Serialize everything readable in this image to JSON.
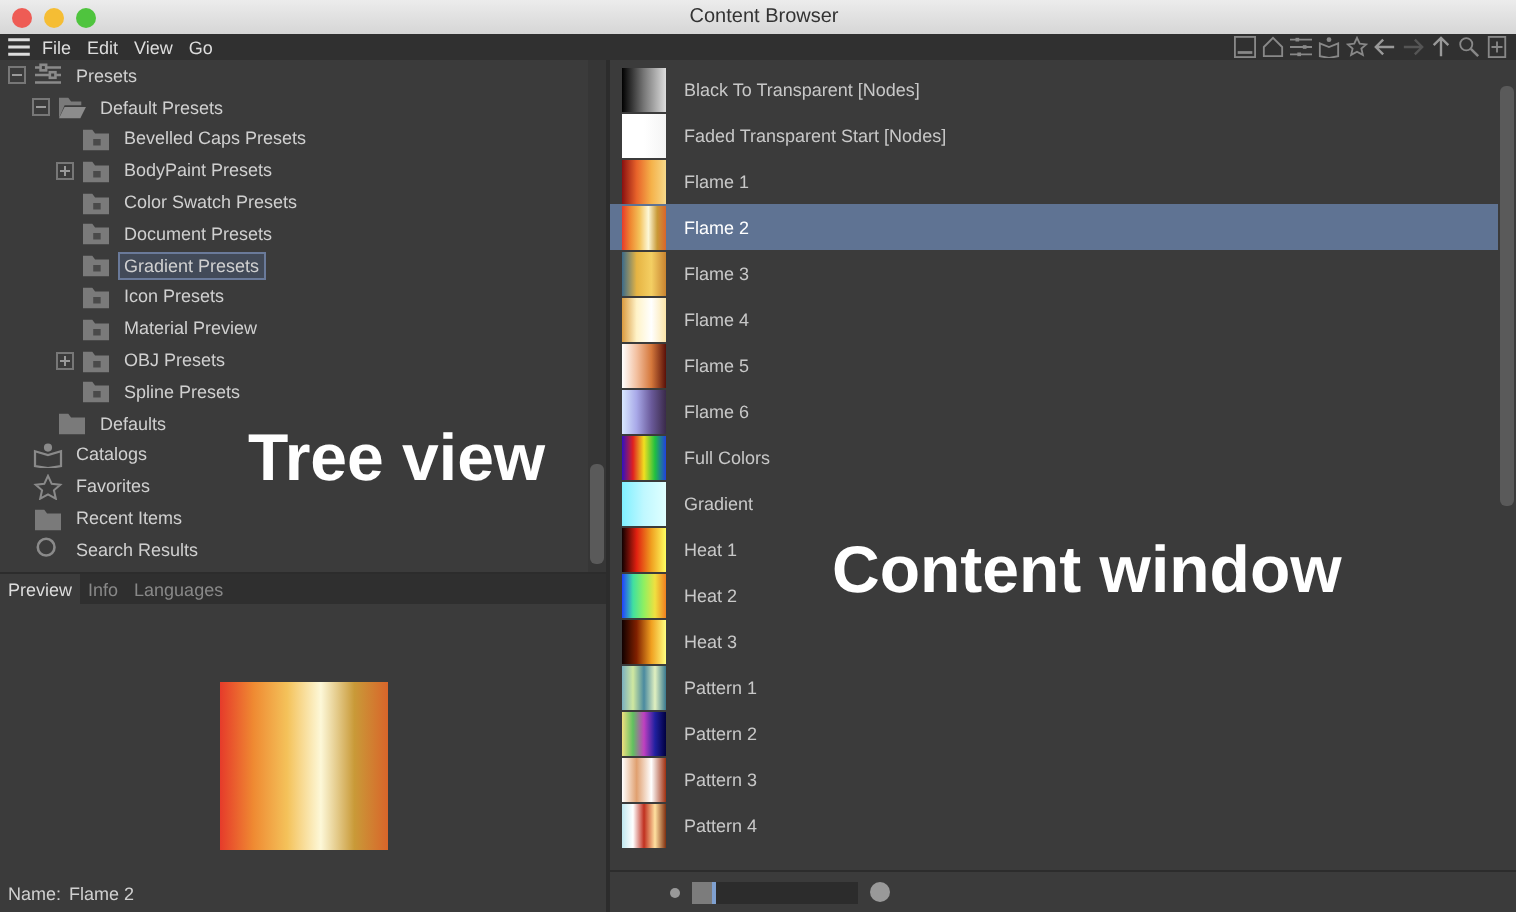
{
  "window": {
    "title": "Content Browser"
  },
  "menu": [
    "File",
    "Edit",
    "View",
    "Go"
  ],
  "tree": [
    {
      "label": "Presets",
      "kind": "presets",
      "expanded": true,
      "selected": false,
      "children": [
        {
          "label": "Default Presets",
          "kind": "folder-open",
          "expanded": true,
          "selected": false,
          "children": [
            {
              "label": "Bevelled Caps Presets",
              "kind": "locked-folder",
              "selected": false
            },
            {
              "label": "BodyPaint Presets",
              "kind": "locked-folder",
              "expanded": false,
              "selected": false
            },
            {
              "label": "Color Swatch Presets",
              "kind": "locked-folder",
              "selected": false
            },
            {
              "label": "Document Presets",
              "kind": "locked-folder",
              "selected": false
            },
            {
              "label": "Gradient Presets",
              "kind": "locked-folder",
              "selected": true
            },
            {
              "label": "Icon Presets",
              "kind": "locked-folder",
              "selected": false
            },
            {
              "label": "Material Preview",
              "kind": "locked-folder",
              "selected": false
            },
            {
              "label": "OBJ Presets",
              "kind": "locked-folder",
              "expanded": false,
              "selected": false
            },
            {
              "label": "Spline Presets",
              "kind": "locked-folder",
              "selected": false
            }
          ]
        },
        {
          "label": "Defaults",
          "kind": "folder",
          "selected": false
        }
      ]
    },
    {
      "label": "Catalogs",
      "kind": "catalog",
      "selected": false
    },
    {
      "label": "Favorites",
      "kind": "star",
      "selected": false
    },
    {
      "label": "Recent Items",
      "kind": "folder",
      "selected": false
    },
    {
      "label": "Search Results",
      "kind": "search",
      "selected": false
    }
  ],
  "tabs": [
    {
      "label": "Preview",
      "selected": true
    },
    {
      "label": "Info",
      "selected": false
    },
    {
      "label": "Languages",
      "selected": false
    }
  ],
  "preview": {
    "name_label": "Name:",
    "name": "Flame 2"
  },
  "items": [
    {
      "label": "Black To Transparent [Nodes]",
      "selected": false
    },
    {
      "label": "Faded Transparent Start [Nodes]",
      "selected": false
    },
    {
      "label": "Flame 1",
      "selected": false
    },
    {
      "label": "Flame 2",
      "selected": true
    },
    {
      "label": "Flame 3",
      "selected": false
    },
    {
      "label": "Flame 4",
      "selected": false
    },
    {
      "label": "Flame 5",
      "selected": false
    },
    {
      "label": "Flame 6",
      "selected": false
    },
    {
      "label": "Full Colors",
      "selected": false
    },
    {
      "label": "Gradient",
      "selected": false
    },
    {
      "label": "Heat 1",
      "selected": false
    },
    {
      "label": "Heat 2",
      "selected": false
    },
    {
      "label": "Heat 3",
      "selected": false
    },
    {
      "label": "Pattern 1",
      "selected": false
    },
    {
      "label": "Pattern 2",
      "selected": false
    },
    {
      "label": "Pattern 3",
      "selected": false
    },
    {
      "label": "Pattern 4",
      "selected": false
    }
  ],
  "thumb_size": {
    "level": 0.15
  },
  "annotations": [
    {
      "text": "Tree view"
    },
    {
      "text": "Content window"
    }
  ]
}
